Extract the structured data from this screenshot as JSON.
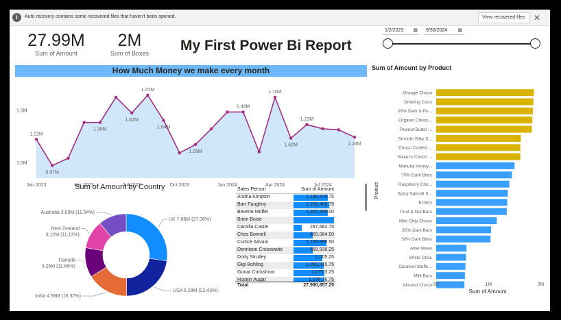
{
  "banner": {
    "message": "Auto recovery contains some recovered files that haven't been opened.",
    "button": "View recovered files",
    "close": "✕",
    "info_icon": "i"
  },
  "kpis": [
    {
      "value": "27.99M",
      "label": "Sum of Amount"
    },
    {
      "value": "2M",
      "label": "Sum of Boxes"
    }
  ],
  "report_title": "My First Power Bi Report",
  "date_slicer": {
    "start": "1/2/2023",
    "end": "9/30/2024",
    "calendar_icon": "calendar-icon"
  },
  "line_chart_title": "How Much Money we make every month",
  "donut_title": "Sum of Amount by Country",
  "bar_chart_title": "Sum of Amount by Product",
  "table": {
    "headers": [
      "Sales Person",
      "Sum of Amount"
    ],
    "rows": [
      {
        "name": "Andria Kimpton",
        "amount": "1,196,376.75",
        "v": 1196376.75
      },
      {
        "name": "Barr Faughny",
        "amount": "1,250,466.75",
        "v": 1250466.75
      },
      {
        "name": "Beverie Moffet",
        "amount": "1,207,449.00",
        "v": 1207449.0
      },
      {
        "name": "Brien Boise",
        "amount": "",
        "v": 1420000
      },
      {
        "name": "Camilla Castle",
        "amount": "297,582.75",
        "v": 297582.75
      },
      {
        "name": "Ches Bonnell",
        "amount": "665,084.50",
        "v": 665084.5
      },
      {
        "name": "Curtice Advani",
        "amount": "1,159,990.50",
        "v": 1159990.5
      },
      {
        "name": "Dennison Crosswaite",
        "amount": "668,936.25",
        "v": 668936.25
      },
      {
        "name": "Dotty Strutley",
        "amount": "1,005,25",
        "v": 1005250
      },
      {
        "name": "Gigi Bohling",
        "amount": "1,061,815.75",
        "v": 1061815.75
      },
      {
        "name": "Gunar Cockshoot",
        "amount": "1,075,3.25",
        "v": 1075300
      },
      {
        "name": "Husein Augar",
        "amount": "1,076,76.75",
        "v": 1076760
      }
    ],
    "total_label": "Total",
    "total_value": "27,990,857.25"
  },
  "chart_data": [
    {
      "type": "area",
      "title": "How Much Money we make every month",
      "x": [
        "Jan 2023",
        "Feb 2023",
        "Mar 2023",
        "Apr 2023",
        "May 2023",
        "Jun 2023",
        "Jul 2023",
        "Aug 2023",
        "Sep 2023",
        "Oct 2023",
        "Nov 2023",
        "Dec 2023",
        "Jan 2024",
        "Feb 2024",
        "Mar 2024",
        "Apr 2024",
        "May 2024",
        "Jun 2024",
        "Jul 2024",
        "Aug 2024",
        "Sep 2024"
      ],
      "values": [
        1.22,
        0.97,
        1.04,
        1.38,
        1.38,
        1.62,
        1.47,
        1.64,
        1.4,
        1.09,
        1.17,
        1.32,
        1.48,
        1.48,
        1.1,
        1.62,
        1.23,
        1.36,
        1.32,
        1.31,
        1.24
      ],
      "data_labels": [
        {
          "index": 0,
          "text": "1.22M"
        },
        {
          "index": 1,
          "text": "0.97M"
        },
        {
          "index": 4,
          "text": "1.38M"
        },
        {
          "index": 6,
          "text": "1.62M"
        },
        {
          "index": 7,
          "text": "1.47M"
        },
        {
          "index": 8,
          "text": "1.64M"
        },
        {
          "index": 10,
          "text": "1.09M"
        },
        {
          "index": 13,
          "text": "1.48M"
        },
        {
          "index": 15,
          "text": "1.10M"
        },
        {
          "index": 16,
          "text": "1.62M"
        },
        {
          "index": 17,
          "text": "1.23M"
        },
        {
          "index": 20,
          "text": "1.24M"
        }
      ],
      "ylim": [
        0.85,
        1.75
      ],
      "y_ticks": [
        {
          "v": 1.0,
          "label": "1.0M"
        },
        {
          "v": 1.5,
          "label": "1.5M"
        }
      ],
      "x_ticks": [
        {
          "index": 0,
          "label": "Jan 2023"
        },
        {
          "index": 3,
          "label": "Apr 2023"
        },
        {
          "index": 6,
          "label": "Jul 2023"
        },
        {
          "index": 9,
          "label": "Oct 2023"
        },
        {
          "index": 12,
          "label": "Jan 2024"
        },
        {
          "index": 15,
          "label": "Apr 2024"
        },
        {
          "index": 18,
          "label": "Jul 2024"
        }
      ],
      "colors": {
        "line": "#a1317f",
        "fill": "#cfe6fb"
      }
    },
    {
      "type": "pie",
      "title": "Sum of Amount by Country",
      "slices": [
        {
          "name": "UK",
          "value": 27.36,
          "label": "UK 7.66M (27.36%)",
          "color": "#118dff"
        },
        {
          "name": "USA",
          "value": 22.43,
          "label": "USA 6.28M (22.43%)",
          "color": "#12239e"
        },
        {
          "name": "India",
          "value": 16.37,
          "label": "India 4.58M (16.37%)",
          "color": "#e66c37"
        },
        {
          "name": "Canada",
          "value": 11.66,
          "label": "Canada\n3.26M (11.66%)",
          "color": "#6b007b"
        },
        {
          "name": "New Zealand",
          "value": 11.13,
          "label": "New Zealand\n3.12M (11.13%)",
          "color": "#e044a7"
        },
        {
          "name": "Australia",
          "value": 11.04,
          "label": "Australia 3.09M (11.04%)",
          "color": "#744ec2"
        }
      ]
    },
    {
      "type": "bar",
      "orientation": "horizontal",
      "title": "Sum of Amount by Product",
      "xlabel": "Sum of Amount",
      "ylabel": "Product",
      "xlim": [
        0,
        2.1
      ],
      "x_ticks": [
        {
          "v": 0,
          "label": "0M"
        },
        {
          "v": 1,
          "label": "1M"
        },
        {
          "v": 2,
          "label": "2M"
        }
      ],
      "categories": [
        "Orange Choco",
        "Drinking Coco",
        "99% Dark & Pu...",
        "Organic Choco...",
        "Peanut Butter ...",
        "Smooth Silky S...",
        "Choco Coated ...",
        "Baker's Choco ...",
        "Manuka Honey...",
        "70% Dark Bites",
        "Raspberry Cho...",
        "Spicy Special S...",
        "Eclairs",
        "Fruit & Nut Bars",
        "Mint Chip Choco",
        "85% Dark Bars",
        "50% Dark Bites",
        "After Nines",
        "White Choc",
        "Caramel Stuffe...",
        "Milk Bars",
        "Almond Choco"
      ],
      "values": [
        1.87,
        1.86,
        1.85,
        1.84,
        1.83,
        1.62,
        1.61,
        1.61,
        1.5,
        1.45,
        1.4,
        1.37,
        1.36,
        1.35,
        1.16,
        1.05,
        1.04,
        0.58,
        0.57,
        0.56,
        0.55,
        0.54
      ],
      "highlight_count": 8,
      "colors": {
        "highlight": "#d9b300",
        "normal": "#3aa0ff"
      }
    }
  ]
}
